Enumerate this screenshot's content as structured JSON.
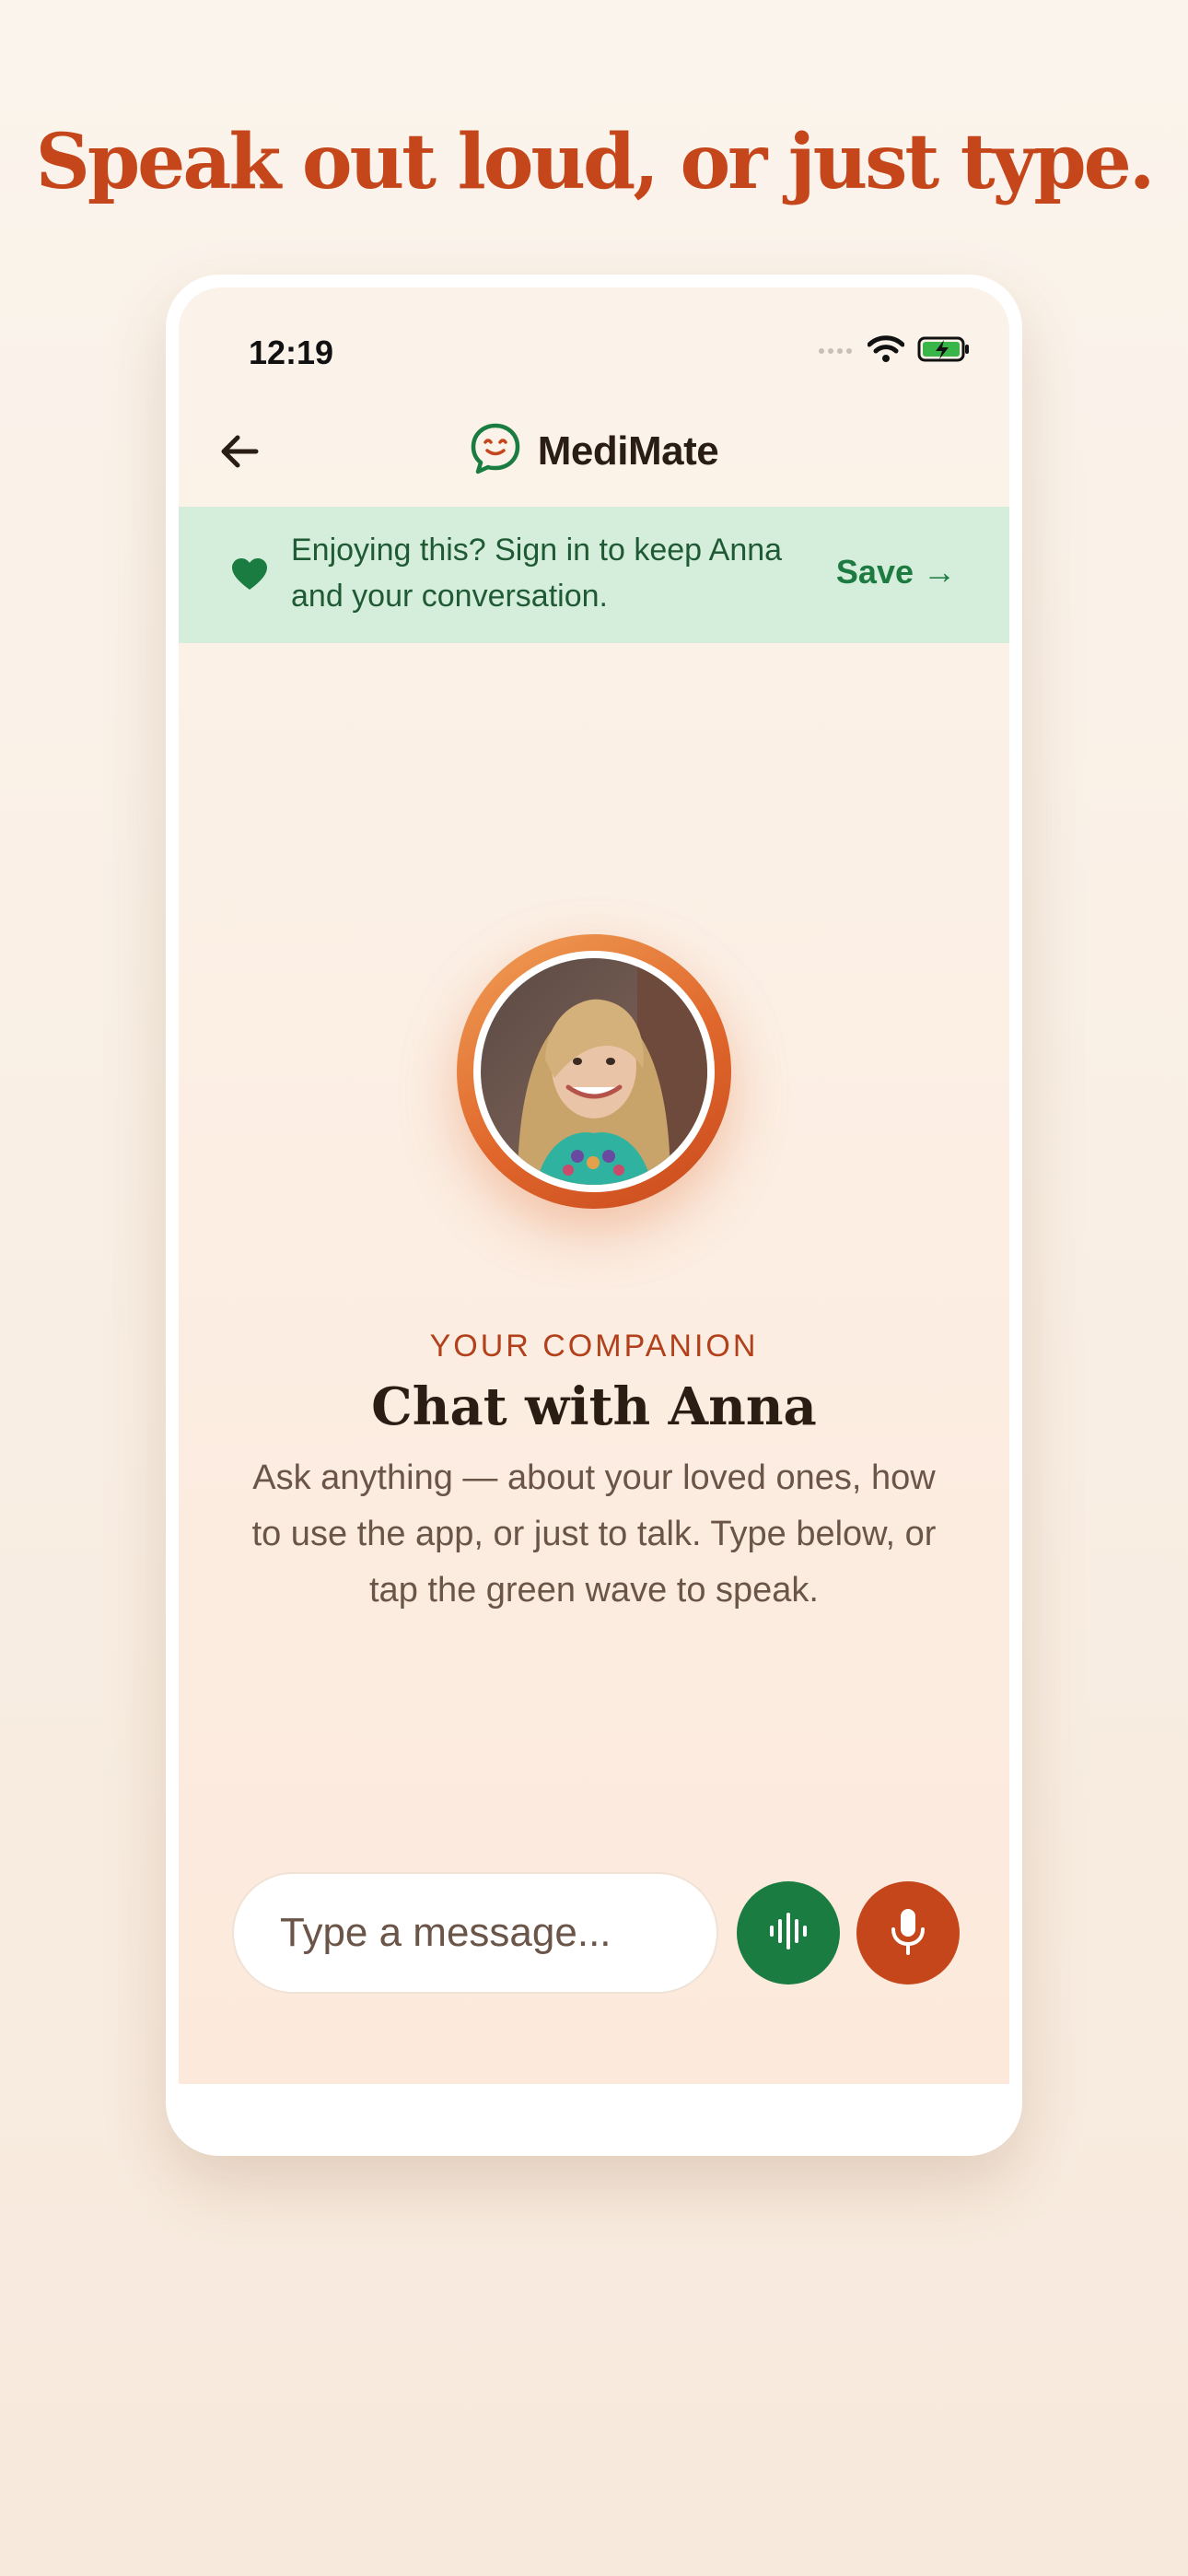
{
  "headline": "Speak out loud, or just type.",
  "status_bar": {
    "time": "12:19",
    "icons": [
      "cellular-dots-icon",
      "wifi-icon",
      "battery-charging-icon"
    ]
  },
  "header": {
    "back_icon": "arrow-left-icon",
    "logo_icon": "smiling-chat-bubble-icon",
    "brand_name": "MediMate"
  },
  "banner": {
    "icon": "heart-icon",
    "text": "Enjoying this? Sign in to keep Anna and your conversation.",
    "action_label": "Save →"
  },
  "companion": {
    "eyebrow": "YOUR COMPANION",
    "title": "Chat with Anna",
    "description": "Ask anything — about your loved ones, how to use the app, or just to talk. Type below, or tap the green wave to speak."
  },
  "composer": {
    "placeholder": "Type a message...",
    "voice_wave_icon": "sound-wave-icon",
    "mic_icon": "microphone-icon"
  },
  "colors": {
    "accent_orange": "#c4461a",
    "accent_green": "#1a7c40",
    "banner_bg": "#d4eedb",
    "text_dark": "#2a1d14"
  }
}
